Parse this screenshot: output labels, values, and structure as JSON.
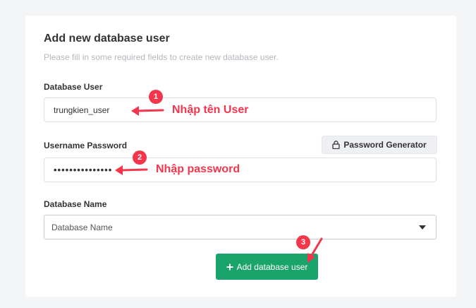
{
  "form": {
    "title": "Add new database user",
    "subtitle": "Please fill in some required fields to create new database user.",
    "db_user_label": "Database User",
    "db_user_value": "trungkien_user",
    "password_label": "Username Password",
    "password_generator_label": "Password Generator",
    "password_value": "•••••••••••••••",
    "db_name_label": "Database Name",
    "db_name_selected": "Database Name",
    "submit_label": "Add database user"
  },
  "annotations": {
    "step1_number": "1",
    "step1_text": "Nhập tên User",
    "step2_number": "2",
    "step2_text": "Nhập password",
    "step3_number": "3"
  },
  "colors": {
    "annotation": "#f4364c",
    "primary_button": "#1aa36a"
  },
  "icons": {
    "generator": "lock-icon",
    "submit": "plus-icon",
    "select": "caret-down-icon"
  }
}
